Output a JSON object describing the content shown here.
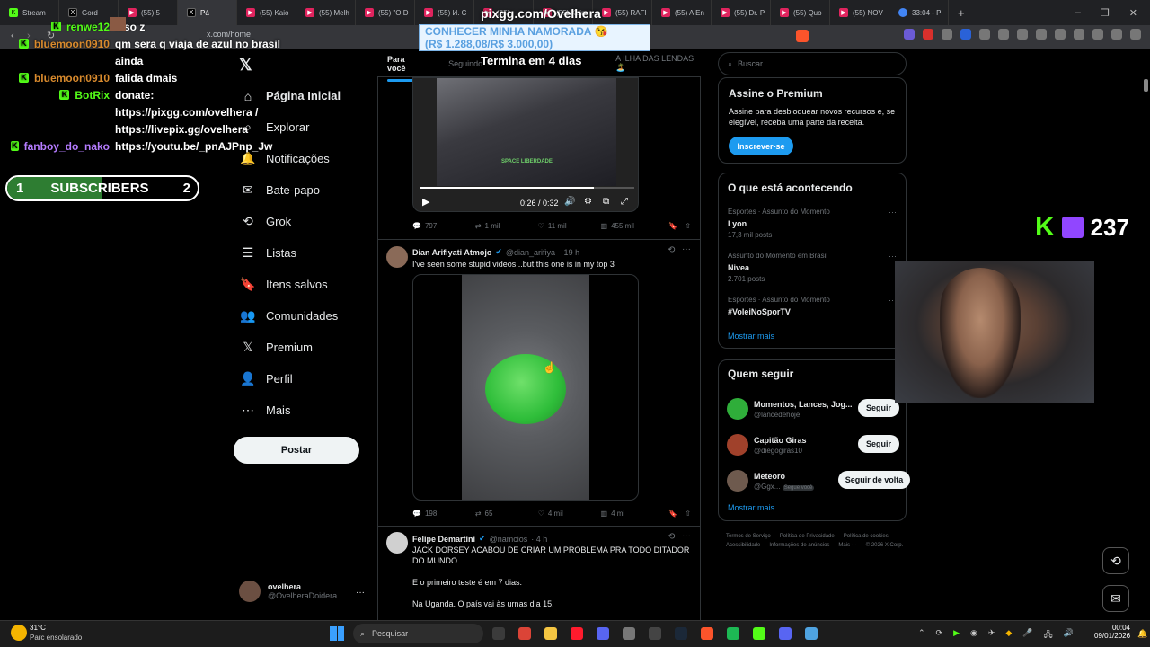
{
  "browser": {
    "tabs": [
      {
        "label": "Stream",
        "icon": "kick-icon"
      },
      {
        "label": "Gord",
        "icon": "x-icon"
      },
      {
        "label": "(55) 5",
        "icon": "youtube-icon"
      },
      {
        "label": "Pá",
        "icon": "x-icon",
        "active": true
      },
      {
        "label": "(55) Kaio",
        "icon": "youtube-icon"
      },
      {
        "label": "(55) Melh",
        "icon": "youtube-icon"
      },
      {
        "label": "(55) \"O D",
        "icon": "youtube-icon"
      },
      {
        "label": "(55) И. С",
        "icon": "youtube-icon"
      },
      {
        "label": "(55)",
        "icon": "youtube-icon"
      },
      {
        "label": "(55) Keim",
        "icon": "youtube-icon"
      },
      {
        "label": "(55) RAFI",
        "icon": "youtube-icon"
      },
      {
        "label": "(55) A En",
        "icon": "youtube-icon"
      },
      {
        "label": "(55) Dr. P",
        "icon": "youtube-icon"
      },
      {
        "label": "(55) Quo",
        "icon": "youtube-icon"
      },
      {
        "label": "(55) NOV",
        "icon": "youtube-icon"
      },
      {
        "label": "33:04 - P",
        "icon": "google-icon"
      }
    ],
    "url": "x.com/home"
  },
  "overlay": {
    "chat": [
      {
        "user": "renwe12",
        "msg": "isso z",
        "user_color": "#53fc18"
      },
      {
        "user": "bluemoon0910",
        "msg": "qm sera q viaja de azul no brasil",
        "user_color": "#d88a2d"
      },
      {
        "user": "",
        "msg": "ainda",
        "user_color": "#ffffff"
      },
      {
        "user": "bluemoon0910",
        "msg": "falida dmais",
        "user_color": "#d88a2d"
      },
      {
        "user": "BotRix",
        "msg": "donate:",
        "user_color": "#53fc18"
      },
      {
        "user": "",
        "msg": "https://pixgg.com/ovelhera /",
        "user_color": "#ffffff"
      },
      {
        "user": "",
        "msg": "https://livepix.gg/ovelhera",
        "user_color": "#ffffff"
      },
      {
        "user": "fanboy_do_nako",
        "msg": "https://youtu.be/_pnAJPnp_Jw",
        "user_color": "#b57cff"
      }
    ],
    "subs": {
      "left": "1",
      "label": "SUBSCRIBERS",
      "right": "2",
      "progress": 0.5
    },
    "pixgg": "pixgg.com/Ovelhera",
    "promo_line1": "CONHECER MINHA NAMORADA 😘",
    "promo_line2": "(R$ 1.288,08/R$ 3.000,00)",
    "countdown": "Termina em 4 dias",
    "viewers": "237"
  },
  "nav": {
    "items": [
      {
        "label": "Página Inicial",
        "icon": "home-icon"
      },
      {
        "label": "Explorar",
        "icon": "search-icon"
      },
      {
        "label": "Notificações",
        "icon": "bell-icon"
      },
      {
        "label": "Bate-papo",
        "icon": "mail-icon"
      },
      {
        "label": "Grok",
        "icon": "grok-icon"
      },
      {
        "label": "Listas",
        "icon": "list-icon"
      },
      {
        "label": "Itens salvos",
        "icon": "bookmark-icon"
      },
      {
        "label": "Comunidades",
        "icon": "community-icon"
      },
      {
        "label": "Premium",
        "icon": "x-icon"
      },
      {
        "label": "Perfil",
        "icon": "person-icon"
      },
      {
        "label": "Mais",
        "icon": "more-icon"
      }
    ],
    "post": "Postar",
    "me_name": "ovelhera",
    "me_handle": "@OvelheraDoidera"
  },
  "feed": {
    "tabs": [
      "Para você",
      "Seguindo",
      "A ILHA DAS LENDAS 🏝️"
    ],
    "post1": {
      "video_time": "0:26 / 0:32",
      "watermark": "SPACE LIBERDADE",
      "replies": "797",
      "reposts": "1 mil",
      "likes": "11 mil",
      "views": "455 mil",
      "progress": 0.81
    },
    "post2": {
      "name": "Dian Arifiyati Atmojo",
      "handle": "@dian_arifiya",
      "time": "· 19 h",
      "text": "I've seen some stupid videos...but this one is in my top 3",
      "replies": "198",
      "reposts": "65",
      "likes": "4 mil",
      "views": "4 mi"
    },
    "post3": {
      "name": "Felipe Demartini",
      "handle": "@namcios",
      "time": "· 4 h",
      "text1": "JACK DORSEY ACABOU DE CRIAR UM PROBLEMA PRA TODO DITADOR DO MUNDO",
      "text2": "E o primeiro teste é em 7 dias.",
      "text3": "Na Uganda. O país vai às urnas dia 15."
    }
  },
  "right": {
    "search_placeholder": "Buscar",
    "premium": {
      "title": "Assine o Premium",
      "text": "Assine para desbloquear novos recursos e, se elegível, receba uma parte da receita.",
      "button": "Inscrever-se"
    },
    "trends_title": "O que está acontecendo",
    "trends": [
      {
        "context": "Esportes · Assunto do Momento",
        "name": "Lyon",
        "count": "17,3 mil posts"
      },
      {
        "context": "Assunto do Momento em Brasil",
        "name": "Nivea",
        "count": "2.701 posts"
      },
      {
        "context": "Esportes · Assunto do Momento",
        "name": "#VoleiNoSporTV",
        "count": ""
      }
    ],
    "show_more": "Mostrar mais",
    "follow_title": "Quem seguir",
    "follow": [
      {
        "name": "Momentos, Lances, Jog...",
        "handle": "@lancedehoje",
        "button": "Seguir",
        "badge": ""
      },
      {
        "name": "Capitão Giras",
        "handle": "@diegogiras10",
        "button": "Seguir",
        "badge": ""
      },
      {
        "name": "Meteoro",
        "handle": "@Ggx...",
        "button": "Seguir de volta",
        "badge": "Segue você"
      }
    ],
    "show_more2": "Mostrar mais",
    "footer": [
      "Termos de Serviço",
      "Política de Privacidade",
      "Política de cookies",
      "Acessibilidade",
      "Informações de anúncios",
      "Mais ···",
      "© 2026 X Corp."
    ]
  },
  "taskbar": {
    "weather_temp": "31°C",
    "weather_text": "Parc ensolarado",
    "search": "Pesquisar",
    "time": "00:04",
    "date": "09/01/2026"
  }
}
